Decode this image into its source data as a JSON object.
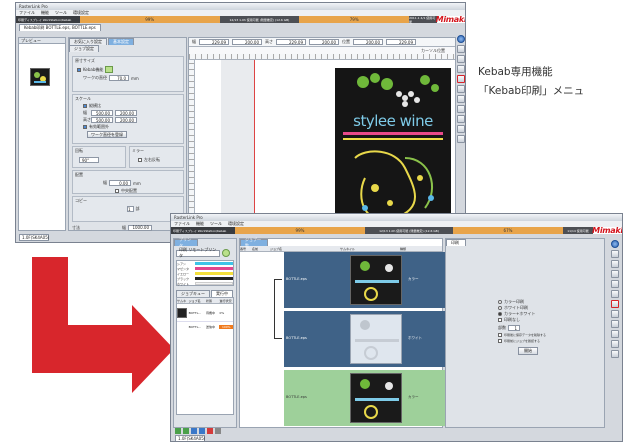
{
  "top_window": {
    "title": "RasterLink Pro",
    "menu": [
      "ファイル",
      "機能",
      "ツール",
      "環境設定"
    ],
    "status": {
      "printer": "印刷ディスプレイ WorkStation/Kebab",
      "progress_1": "99%",
      "info_1": "12/13 1.0h 使用可能 (残量推定) (12.6 GB)",
      "progress_2": "79%",
      "info_2": "2011.1 4/1 使用可能"
    },
    "brand": "Mimaki",
    "job_tab": "Kebab印刷 BOTTLE.eps, BOTTLE.eps",
    "panel_tabs": [
      "お気に入り設定",
      "ジョブ設定"
    ],
    "active_panel_tab": "基本設定",
    "preview_tab": "プレビュー",
    "sections": {
      "size": "原寸サイズ",
      "scale": "スケール",
      "rotate": "回転",
      "mirror": "ミラー",
      "position": "配置",
      "copies": "コピー",
      "dims": "寸法"
    },
    "kebab_check": "Kebab機能",
    "work_diameter_label": "ワークの直径",
    "work_diameter": "70.0",
    "unit_mm": "mm",
    "keep_ratio": "縦横比",
    "width_label": "幅",
    "width_val": "500.00",
    "width_pct": "200.00",
    "height_label": "高さ",
    "height_val": "500.00",
    "height_pct": "200.00",
    "fit_check": "有効範囲外",
    "fit_button": "ワーク直径を登録",
    "rotate_val": "90°",
    "mirror_label": "左右反転",
    "position_label": "幅",
    "position_val": "0.00",
    "center_label": "中央配置",
    "copies_val": "1",
    "copies_unit": "部",
    "footer_label": "幅",
    "footer_val": "1000.00",
    "ruler_fields": {
      "w_label": "幅",
      "w1": "229.09",
      "w2": "200.00",
      "h_label": "高さ",
      "h1": "229.09",
      "h2": "200.00",
      "p_label": "位置",
      "p1": "200.00",
      "p2": "229.09"
    },
    "cursor_label": "カーソル位置",
    "artwork_text": "stylee wine",
    "bottom_tab": "1.0F(SK4A05)"
  },
  "bottom_window": {
    "title": "RasterLink Pro",
    "menu": [
      "ファイル",
      "機能",
      "ツール",
      "環境設定"
    ],
    "status": {
      "printer": "印刷ディスプレイ WorkStation/Kebab",
      "progress_1": "99%",
      "info_1": "12/13 1.0h 使用可能 (残量推定) (12.6 GB)",
      "progress_2": "67%",
      "info_2": "11/14 使用可能"
    },
    "brand": "Mimaki",
    "left_tab": "プリンタ",
    "printer_name": "印刷 リモートプリンタ",
    "ink_colors": [
      "#3ec4e8",
      "#e0468e",
      "#f4e03c",
      "#222222",
      "#f4f4f4"
    ],
    "ink_labels": [
      "シアン",
      "マゼンタ",
      "イエロー",
      "ブラック",
      "ホワイト"
    ],
    "list_tabs": [
      "ジョブキュー",
      "実行中"
    ],
    "list_headers": [
      "サムネ",
      "ジョブ名",
      "状態",
      "進行状況"
    ],
    "jobs": [
      {
        "name": "BOTTL...",
        "state": "待機中",
        "progress": "0%"
      },
      {
        "name": "BOTTL...",
        "state": "送信中",
        "progress": "100%"
      }
    ],
    "center_tab": "ジョブ一覧",
    "center_headers": [
      "番号",
      "名前",
      "ジョブ名",
      "サムネイル",
      "種類"
    ],
    "rows": [
      {
        "job": "BOTTLE.eps",
        "kind": "カラー"
      },
      {
        "job": "BOTTLE.eps",
        "kind": "ホワイト"
      },
      {
        "job": "BOTTLE.eps",
        "kind": "カラー"
      }
    ],
    "right_tab": "印刷",
    "options": [
      "カラー印刷",
      "ホワイト印刷",
      "カラー+ホワイト",
      "印刷なし"
    ],
    "copies_label": "部数",
    "copies_val": "1",
    "option_checks": [
      "印刷後に保存データを削除する",
      "印刷前にジョブを確認する"
    ],
    "start_button": "開始",
    "bottom_tab": "1.0F(SK4A05)"
  },
  "annotation": {
    "line1": "Kebab専用機能",
    "line2": "「Kebab印刷」メニュ"
  },
  "arrow_color": "#d8262c"
}
